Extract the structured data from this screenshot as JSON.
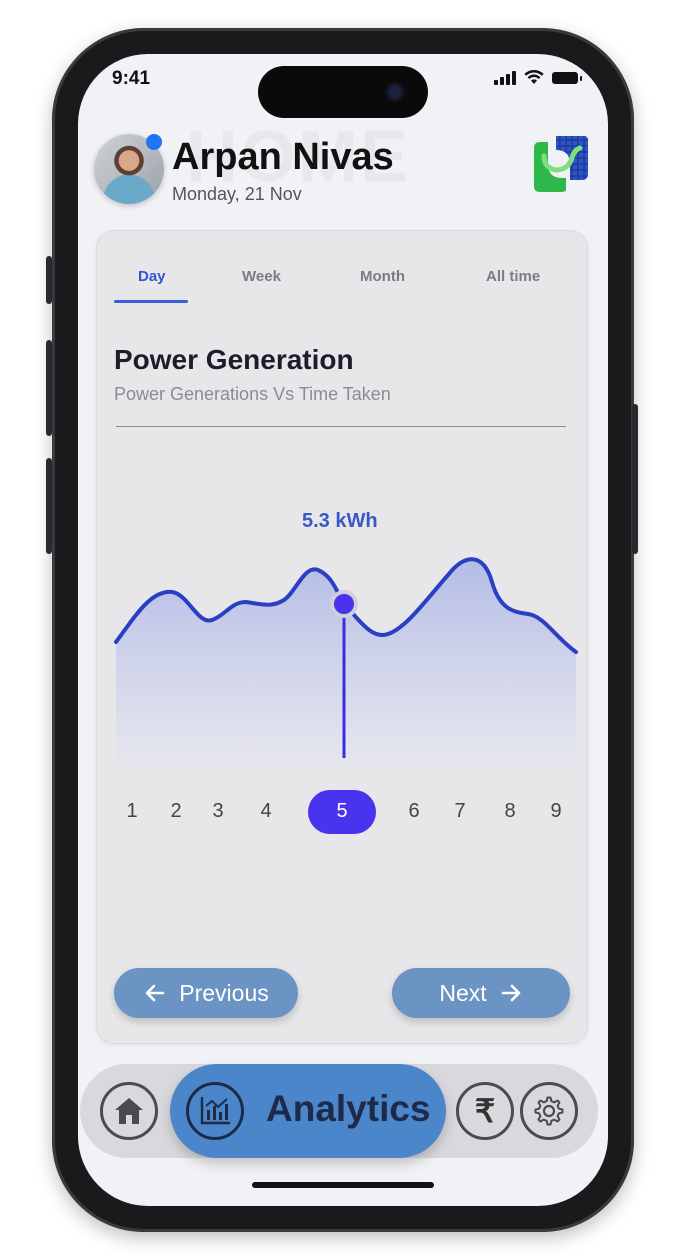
{
  "status": {
    "time": "9:41"
  },
  "header": {
    "watermark": "HOME",
    "user_name": "Arpan Nivas",
    "date": "Monday, 21 Nov"
  },
  "tabs": [
    {
      "label": "Day",
      "active": true
    },
    {
      "label": "Week",
      "active": false
    },
    {
      "label": "Month",
      "active": false
    },
    {
      "label": "All time",
      "active": false
    }
  ],
  "section": {
    "title": "Power Generation",
    "subtitle": "Power Generations Vs Time Taken"
  },
  "chart_data": {
    "type": "area",
    "title": "Power Generation",
    "subtitle": "Power Generations Vs Time Taken",
    "categories": [
      "1",
      "2",
      "3",
      "4",
      "5",
      "6",
      "7",
      "8",
      "9"
    ],
    "selected_index": 4,
    "selected_label": "5.3 kWh",
    "line_color": "#2a3fc4",
    "fill_color": "#b9c2ea",
    "marker_color": "#4a33ef"
  },
  "buttons": {
    "previous": "Previous",
    "next": "Next"
  },
  "nav": {
    "active_label": "Analytics",
    "rupee_symbol": "₹"
  },
  "colors": {
    "accent": "#4a33ef",
    "button": "#6b93c4",
    "nav_active": "#4a86c9",
    "tab_active": "#2f55d4"
  }
}
